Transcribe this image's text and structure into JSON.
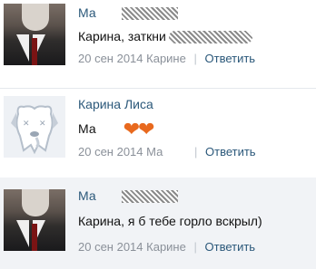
{
  "comments": [
    {
      "author": "Ма",
      "text": "Карина, заткни",
      "date": "20 сен 2014",
      "reply_to": "Карине",
      "separator": "|",
      "reply_label": "Ответить"
    },
    {
      "author": "Карина Лиса",
      "text": "Ма",
      "hearts": "❤❤",
      "date": "20 сен 2014",
      "reply_to": "Ма",
      "separator": "|",
      "reply_label": "Ответить"
    },
    {
      "author": "Ма",
      "text": "Карина, я б тебе горло вскрыл)",
      "date": "20 сен 2014",
      "reply_to": "Карине",
      "separator": "|",
      "reply_label": "Ответить"
    }
  ],
  "colors": {
    "link": "#2b587a",
    "meta": "#8a9099",
    "heart": "#e8691e",
    "highlight_bg": "#f1f3f6"
  }
}
